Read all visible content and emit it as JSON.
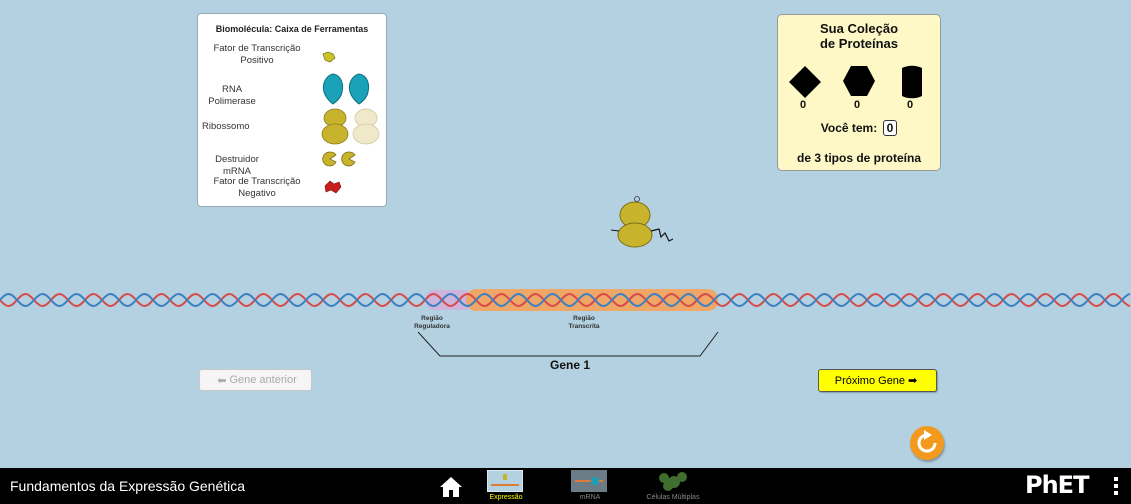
{
  "toolbox": {
    "title": "Biomolécula: Caixa de Ferramentas",
    "items": [
      {
        "label": "Fator de Transcrição Positivo",
        "icon": "positive-transcription-factor-icon"
      },
      {
        "label": "RNA Polimerase",
        "icon": "rna-polymerase-icon"
      },
      {
        "label": "Ribossomo",
        "icon": "ribosome-icon"
      },
      {
        "label": "Destruidor mRNA",
        "icon": "mrna-destroyer-icon"
      },
      {
        "label": "Fator de Transcrição Negativo",
        "icon": "negative-transcription-factor-icon"
      }
    ]
  },
  "collection": {
    "title": "Sua Coleção de Proteínas",
    "counts": [
      "0",
      "0",
      "0"
    ],
    "you_have_label": "Você tem:",
    "you_have_value": "0",
    "types_text": "de 3 tipos de proteína"
  },
  "dna": {
    "regulatory_region": "Região Reguladora",
    "transcribed_region": "Região Transcrita",
    "gene_label": "Gene 1"
  },
  "buttons": {
    "previous_gene": "Gene anterior",
    "next_gene": "Próximo Gene"
  },
  "navbar": {
    "title": "Fundamentos da Expressão Genética",
    "screens": [
      "Expressão",
      "mRNA",
      "Células Múltiplas"
    ],
    "logo": "PhET"
  },
  "colors": {
    "background": "#b4d1e1",
    "dna_strand_1": "#d94a4a",
    "dna_strand_2": "#3b7fc4",
    "transcribed_highlight": "#f5a25a",
    "next_button": "#ffff00",
    "reset_button": "#f39a1e"
  }
}
